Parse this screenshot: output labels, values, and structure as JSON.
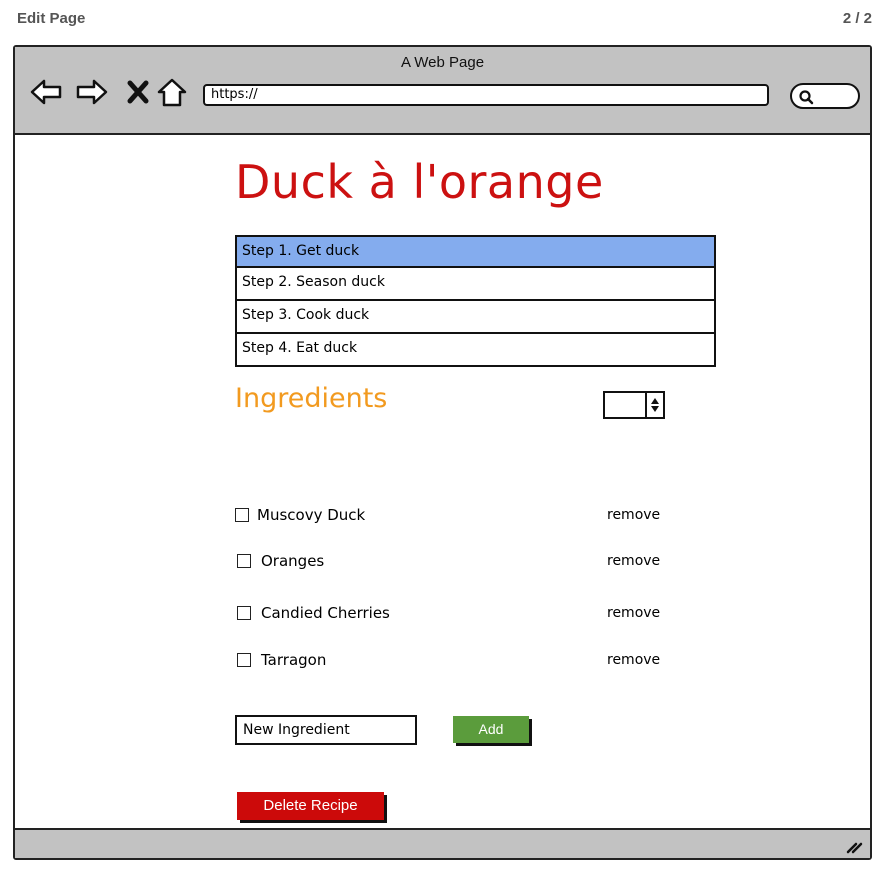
{
  "header": {
    "page_label": "Edit Page",
    "page_count": "2 / 2"
  },
  "browser": {
    "window_title": "A Web Page",
    "url": "https://",
    "nav_icons": [
      "back-arrow-icon",
      "forward-arrow-icon",
      "close-icon",
      "home-icon"
    ],
    "search_icon": "search-icon"
  },
  "recipe": {
    "title": "Duck à l'orange",
    "steps": [
      {
        "label": "Step 1. Get duck",
        "selected": true
      },
      {
        "label": "Step 2. Season duck",
        "selected": false
      },
      {
        "label": "Step 3. Cook duck",
        "selected": false
      },
      {
        "label": "Step 4. Eat duck",
        "selected": false
      }
    ]
  },
  "ingredients": {
    "heading": "Ingredients",
    "stepper_value": "",
    "items": [
      {
        "name": "Muscovy Duck",
        "checked": false,
        "remove_label": "remove"
      },
      {
        "name": "Oranges",
        "checked": false,
        "remove_label": "remove"
      },
      {
        "name": "Candied Cherries",
        "checked": false,
        "remove_label": "remove"
      },
      {
        "name": "Tarragon",
        "checked": false,
        "remove_label": "remove"
      }
    ],
    "new_ingredient_value": "New Ingredient",
    "add_label": "Add"
  },
  "actions": {
    "delete_label": "Delete Recipe"
  },
  "colors": {
    "title": "#cc1111",
    "heading": "#f29a1f",
    "selected_step": "#84acee",
    "add_button": "#5b9c3c",
    "delete_button": "#cc0a0a",
    "chrome": "#c2c2c2"
  }
}
